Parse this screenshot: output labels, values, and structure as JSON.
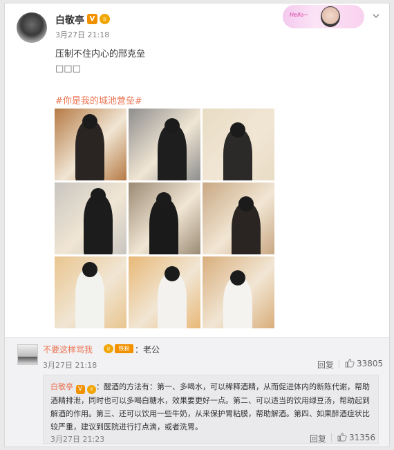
{
  "post": {
    "username": "白敬亭",
    "verified_badge": "V",
    "level_badge": "♕",
    "time": "3月27日 21:18",
    "text_line1": "压制不住内心的邢克垒",
    "text_line2": "□□□",
    "hashtag": "#你是我的城池营垒#",
    "decoration_text": "Hello~",
    "menu_icon": "chevron-down-icon"
  },
  "photos": [
    {
      "label": "photo-1",
      "bg": "#b57a45",
      "fig": "#2a2522"
    },
    {
      "label": "photo-2",
      "bg": "#8e8e8e",
      "fig": "#1e1e1e"
    },
    {
      "label": "photo-3",
      "bg": "#e8dcc4",
      "fig": "#2c2a28"
    },
    {
      "label": "photo-4",
      "bg": "#c8c5c0",
      "fig": "#1c1c1c"
    },
    {
      "label": "photo-5",
      "bg": "#9a8a74",
      "fig": "#1a1a1a"
    },
    {
      "label": "photo-6",
      "bg": "#c9a883",
      "fig": "#2a2522"
    },
    {
      "label": "photo-7",
      "bg": "#e9c58f",
      "fig": "#f2f2ee"
    },
    {
      "label": "photo-8",
      "bg": "#e8b877",
      "fig": "#f4f2ee"
    },
    {
      "label": "photo-9",
      "bg": "#d9ae7c",
      "fig": "#f5f3f0"
    }
  ],
  "comment": {
    "username": "不要这样骂我",
    "level_badge": "♕",
    "fan_badge": "铁粉",
    "text": "：老公",
    "time": "3月27日 21:18",
    "reply_label": "回复",
    "like_count": "33805"
  },
  "reply": {
    "username": "白敬亭",
    "verified_badge": "V",
    "level_badge": "♕",
    "text": "：醒酒的方法有：第一、多喝水，可以稀释酒精，从而促进体内的新陈代谢，帮助酒精排泄，同时也可以多喝白糖水，效果要更好一点。第二、可以适当的饮用绿豆汤，帮助起到解酒的作用。第三、还可以饮用一些牛奶，从来保护胃粘膜，帮助解酒。第四、如果醉酒症状比较严重，建议到医院进行打点滴，或者洗胃。",
    "time": "3月27日 21:23",
    "reply_label": "回复",
    "like_count": "31356"
  },
  "colors": {
    "accent": "#eb7350",
    "badge_orange": "#f29100",
    "text": "#333333",
    "muted": "#808080"
  }
}
